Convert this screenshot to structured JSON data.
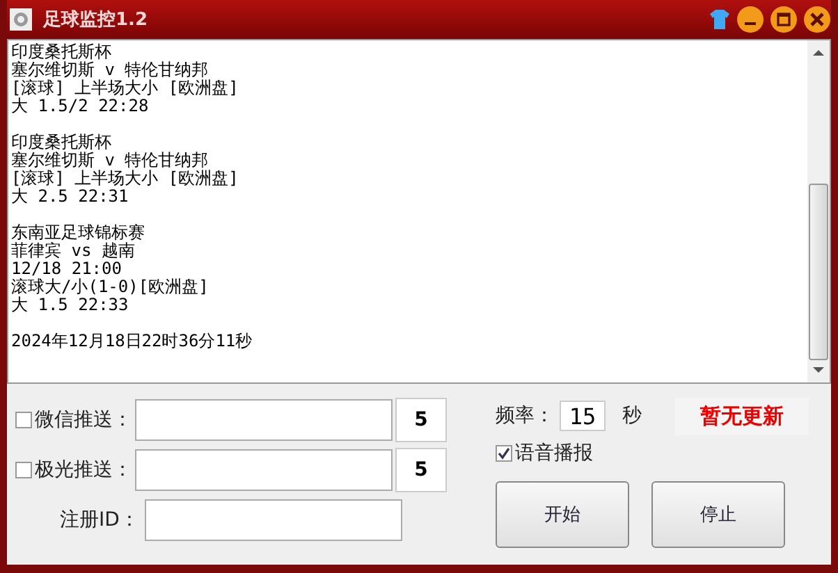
{
  "window": {
    "title": "足球监控1.2"
  },
  "log": [
    {
      "lines": [
        "印度桑托斯杯",
        "塞尔维切斯 v 特伦甘纳邦",
        "[滚球] 上半场大小 [欧洲盘]",
        "大 1.5/2 22:28"
      ]
    },
    {
      "lines": [
        "印度桑托斯杯",
        "塞尔维切斯 v 特伦甘纳邦",
        "[滚球] 上半场大小 [欧洲盘]",
        "大 2.5 22:31"
      ]
    },
    {
      "lines": [
        "东南亚足球锦标赛",
        "菲律宾 vs 越南",
        "12/18 21:00",
        "滚球大/小(1-0)[欧洲盘]",
        "大 1.5 22:33"
      ]
    },
    {
      "lines": [
        "2024年12月18日22时36分11秒"
      ]
    }
  ],
  "push": [
    {
      "label": "微信推送：",
      "checked": false,
      "count": "5"
    },
    {
      "label": "极光推送：",
      "checked": false,
      "count": "5"
    }
  ],
  "register": {
    "label": "注册ID："
  },
  "frequency": {
    "label": "频率：",
    "value": "15",
    "unit": "秒"
  },
  "status": "暂无更新",
  "voice": {
    "label": "语音播报",
    "checked": true
  },
  "buttons": [
    "开始",
    "停止"
  ]
}
